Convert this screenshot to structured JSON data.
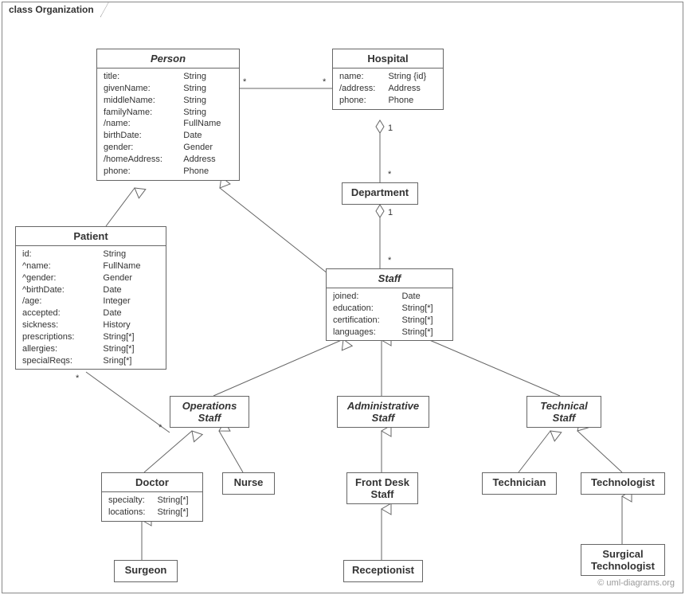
{
  "frame": {
    "label": "class Organization"
  },
  "classes": {
    "person": {
      "name": "Person",
      "attrs": [
        [
          "title:",
          "String"
        ],
        [
          "givenName:",
          "String"
        ],
        [
          "middleName:",
          "String"
        ],
        [
          "familyName:",
          "String"
        ],
        [
          "/name:",
          "FullName"
        ],
        [
          "birthDate:",
          "Date"
        ],
        [
          "gender:",
          "Gender"
        ],
        [
          "/homeAddress:",
          "Address"
        ],
        [
          "phone:",
          "Phone"
        ]
      ]
    },
    "hospital": {
      "name": "Hospital",
      "attrs": [
        [
          "name:",
          "String {id}"
        ],
        [
          "/address:",
          "Address"
        ],
        [
          "phone:",
          "Phone"
        ]
      ]
    },
    "department": {
      "name": "Department"
    },
    "patient": {
      "name": "Patient",
      "attrs": [
        [
          "id:",
          "String"
        ],
        [
          "^name:",
          "FullName"
        ],
        [
          "^gender:",
          "Gender"
        ],
        [
          "^birthDate:",
          "Date"
        ],
        [
          "/age:",
          "Integer"
        ],
        [
          "accepted:",
          "Date"
        ],
        [
          "sickness:",
          "History"
        ],
        [
          "prescriptions:",
          "String[*]"
        ],
        [
          "allergies:",
          "String[*]"
        ],
        [
          "specialReqs:",
          "Sring[*]"
        ]
      ]
    },
    "staff": {
      "name": "Staff",
      "attrs": [
        [
          "joined:",
          "Date"
        ],
        [
          "education:",
          "String[*]"
        ],
        [
          "certification:",
          "String[*]"
        ],
        [
          "languages:",
          "String[*]"
        ]
      ]
    },
    "opsStaff": {
      "name1": "Operations",
      "name2": "Staff"
    },
    "adminStaff": {
      "name1": "Administrative",
      "name2": "Staff"
    },
    "techStaff": {
      "name1": "Technical",
      "name2": "Staff"
    },
    "doctor": {
      "name": "Doctor",
      "attrs": [
        [
          "specialty:",
          "String[*]"
        ],
        [
          "locations:",
          "String[*]"
        ]
      ]
    },
    "nurse": {
      "name": "Nurse"
    },
    "frontDesk": {
      "name1": "Front Desk",
      "name2": "Staff"
    },
    "technician": {
      "name": "Technician"
    },
    "technologist": {
      "name": "Technologist"
    },
    "surgeon": {
      "name": "Surgeon"
    },
    "receptionist": {
      "name": "Receptionist"
    },
    "surgTech": {
      "name1": "Surgical",
      "name2": "Technologist"
    }
  },
  "mult": {
    "personHosp_p": "*",
    "personHosp_h": "*",
    "hospDept_h": "1",
    "hospDept_d": "*",
    "deptStaff_d": "1",
    "deptStaff_s": "*",
    "patientOps_p": "*",
    "patientOps_o": "*"
  },
  "watermark": "© uml-diagrams.org"
}
